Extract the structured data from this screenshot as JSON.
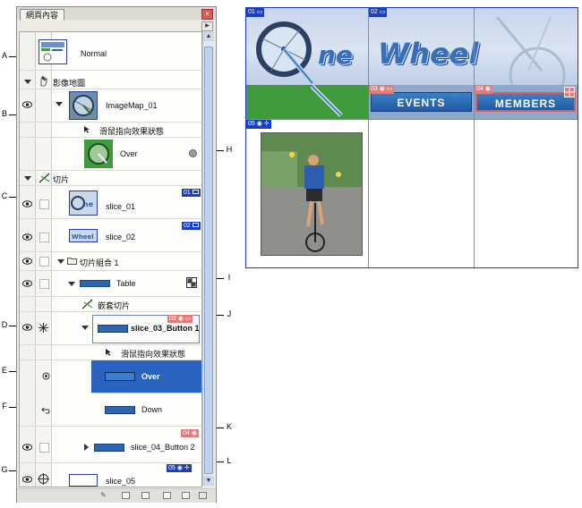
{
  "panel": {
    "title": "網頁內容",
    "rows": {
      "normal": "Normal",
      "imagemap_layer": "影像地圖",
      "imagemap": "ImageMap_01",
      "rollover_group": "滑鼠指向效果狀態",
      "over_state": "Over",
      "slices_layer": "切片",
      "slice_01": "slice_01",
      "slice_02": "slice_02",
      "slice_set": "切片組合 1",
      "table": "Table",
      "nested_slices": "嵌套切片",
      "slice_03": "slice_03_Button 1",
      "rollover_group_2": "滑鼠指向效果狀態",
      "over_state_2": "Over",
      "down_state": "Down",
      "slice_04": "slice_04_Button 2",
      "slice_05": "slice_05"
    },
    "badges": {
      "b01": "01",
      "b02": "02",
      "b03": "03",
      "b04": "04",
      "b05": "05"
    }
  },
  "callouts": [
    "A",
    "B",
    "C",
    "D",
    "E",
    "F",
    "G",
    "H",
    "I",
    "J",
    "K",
    "L"
  ],
  "preview": {
    "badges": [
      "01",
      "02",
      "03",
      "04",
      "05"
    ],
    "logo_part1": "ne",
    "logo_part2": "Wheel",
    "button_events": "EVENTS",
    "button_members": "MEMBERS"
  },
  "colors": {
    "slice_blue": "#1a3fc4",
    "slice_red": "#e47b7b",
    "selected_row": "#2a62bf",
    "green_bar": "#3f9b3d"
  },
  "icons": [
    "eye-icon",
    "hand-icon",
    "crosshair-icon",
    "scissors-icon",
    "folder-icon",
    "table-icon",
    "trash-icon"
  ]
}
